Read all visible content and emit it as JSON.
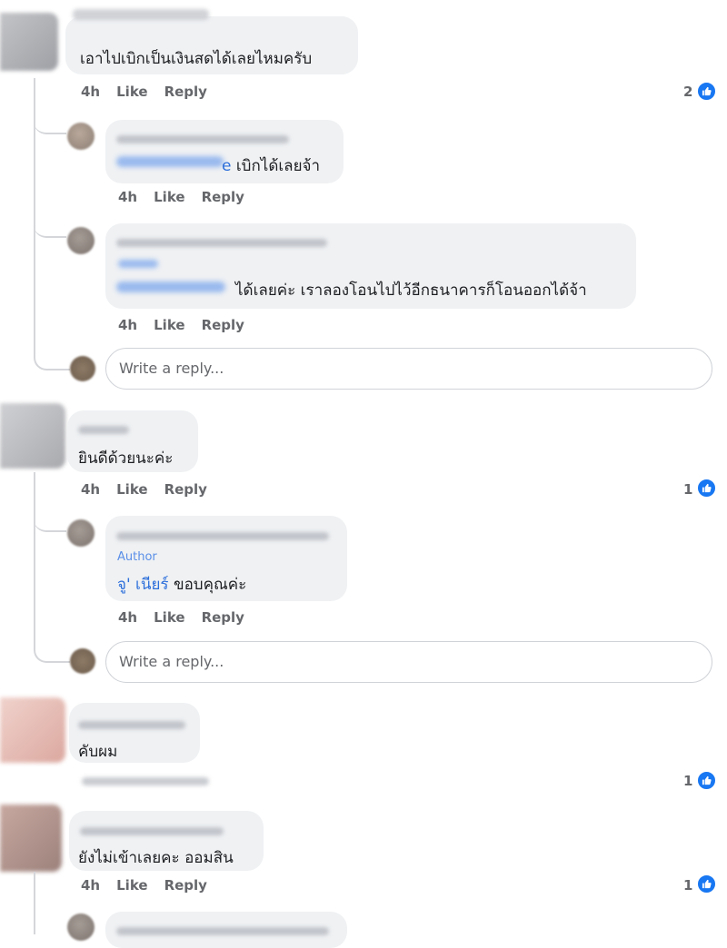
{
  "comments": [
    {
      "text": "เอาไปเบิกเป็นเงินสดได้เลยไหมครับ",
      "time": "4h",
      "like": "Like",
      "reply": "Reply",
      "reactions": "2",
      "replies": [
        {
          "mention_suffix": "e",
          "text": "เบิกได้เลยจ้า",
          "time": "4h",
          "like": "Like",
          "reply": "Reply"
        },
        {
          "text": "ได้เลยค่ะ เราลองโอนไปไว้อีกธนาคารก็โอนออกได้จ้า",
          "time": "4h",
          "like": "Like",
          "reply": "Reply"
        }
      ],
      "reply_placeholder": "Write a reply..."
    },
    {
      "text": "ยินดีด้วยนะค่ะ",
      "time": "4h",
      "like": "Like",
      "reply": "Reply",
      "reactions": "1",
      "replies": [
        {
          "author_badge": "Author",
          "mention": "จู' เนียร์",
          "text": "ขอบคุณค่ะ",
          "time": "4h",
          "like": "Like",
          "reply": "Reply"
        }
      ],
      "reply_placeholder": "Write a reply..."
    },
    {
      "text": "คับผม",
      "reactions": "1"
    },
    {
      "text": "ยังไม่เข้าเลยคะ ออมสิน",
      "time": "4h",
      "like": "Like",
      "reply": "Reply",
      "reactions": "1"
    }
  ],
  "colors": {
    "like_blue": "#1877f2",
    "bubble": "#eff1f3",
    "link": "#2d6fdb"
  },
  "icons": {
    "reaction": "thumbs-up-icon"
  }
}
